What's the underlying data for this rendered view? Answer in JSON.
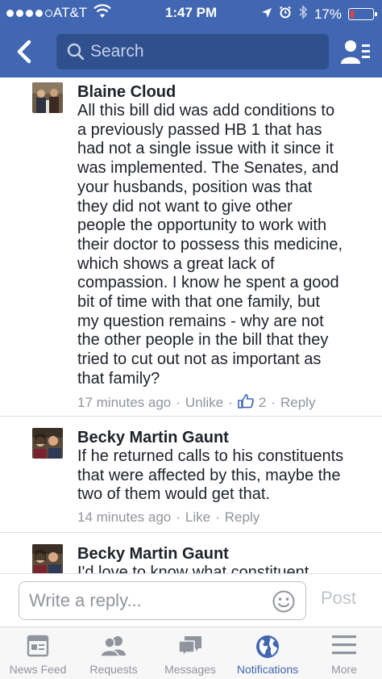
{
  "status_bar": {
    "carrier": "AT&T",
    "time": "1:47 PM",
    "battery": "17%",
    "battery_level": 0.17
  },
  "nav": {
    "search_placeholder": "Search"
  },
  "comments": [
    {
      "author": "Blaine Cloud",
      "lines": [
        "All this bill did was add conditions to",
        "a previously passed HB 1 that has",
        "had not a single issue with it since it",
        "was implemented. The Senates, and",
        "your husbands, position was that",
        "they did not want to give other",
        "people the opportunity to work with",
        "their doctor to possess this medicine,",
        "which shows a great lack of",
        "compassion. I know he spent a good",
        "bit of time with that one family, but",
        "my question remains - why are not",
        "the other people in the bill that they",
        "tried to cut out not as important as",
        "that family?"
      ],
      "time": "17 minutes ago",
      "like_action": "Unlike",
      "like_count": "2",
      "reply": "Reply"
    },
    {
      "author": "Becky Martin Gaunt",
      "lines": [
        "If he returned calls to his constituents",
        "that were affected by this, maybe the",
        "two of them would get that."
      ],
      "time": "14 minutes ago",
      "like_action": "Like",
      "reply": "Reply"
    },
    {
      "author": "Becky Martin Gaunt",
      "lines": [
        "I'd love to know what constituent"
      ]
    }
  ],
  "reply_bar": {
    "placeholder": "Write a reply...",
    "post_label": "Post"
  },
  "tabs": [
    {
      "label": "News Feed",
      "icon": "news-feed-icon",
      "active": false
    },
    {
      "label": "Requests",
      "icon": "friend-requests-icon",
      "active": false
    },
    {
      "label": "Messages",
      "icon": "messages-icon",
      "active": false
    },
    {
      "label": "Notifications",
      "icon": "globe-icon",
      "active": true
    },
    {
      "label": "More",
      "icon": "menu-icon",
      "active": false
    }
  ],
  "colors": {
    "brand_blue": "#4267b2",
    "battery_low": "#ff3b30",
    "meta_gray": "#90949c"
  }
}
